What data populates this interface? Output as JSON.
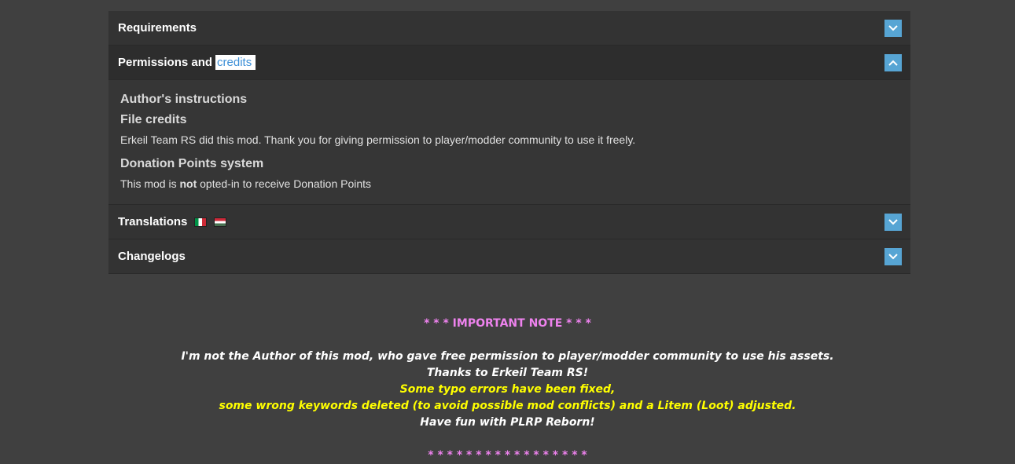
{
  "accordion": {
    "requirements": {
      "label": "Requirements"
    },
    "permissions": {
      "label_prefix": "Permissions and",
      "label_highlight": "credits",
      "authors_instructions_heading": "Author's instructions",
      "file_credits_heading": "File credits",
      "file_credits_text": "Erkeil Team RS did this mod. Thank you for giving permission to player/modder community to use it freely.",
      "donation_heading": "Donation Points system",
      "donation_text_before": "This mod is ",
      "donation_text_bold": "not",
      "donation_text_after": " opted-in to receive Donation Points"
    },
    "translations": {
      "label": "Translations",
      "flags": [
        "italian-flag",
        "hungarian-flag"
      ]
    },
    "changelogs": {
      "label": "Changelogs"
    }
  },
  "note": {
    "title": "* * * IMPORTANT NOTE * * *",
    "line1": "I'm not the Author of this mod, who gave free permission to player/modder community to use his assets.",
    "line2": "Thanks to Erkeil Team RS!",
    "line3": "Some typo errors have been fixed,",
    "line4": "some wrong keywords deleted (to avoid possible mod conflicts) and a Litem (Loot) adjusted.",
    "line5": "Have fun with PLRP Reborn!",
    "footer": "* * * * * * * * * * * * * * * * *"
  },
  "colors": {
    "background": "#404040",
    "toggle": "#57a5d4",
    "note_title": "#ee82ee",
    "note_yellow": "#ffff00"
  }
}
